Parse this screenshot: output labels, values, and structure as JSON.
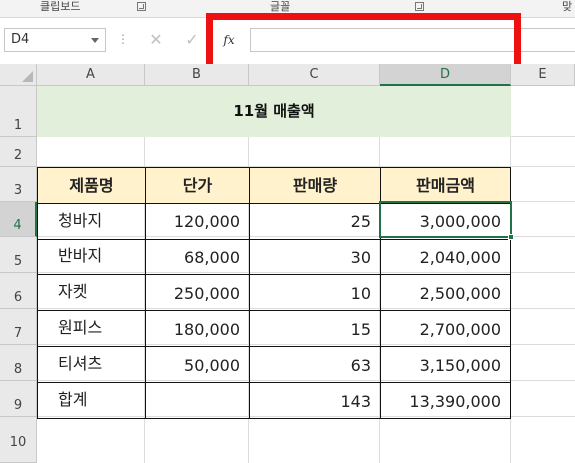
{
  "ribbon": {
    "groups": [
      "클립보드",
      "글꼴",
      "맞"
    ]
  },
  "formula_bar": {
    "name_box": "D4",
    "cancel_icon": "✕",
    "enter_icon": "✓",
    "fx_label": "fx",
    "formula": "",
    "dots": "⋮"
  },
  "grid": {
    "columns": [
      "A",
      "B",
      "C",
      "D",
      "E"
    ],
    "rows": [
      "1",
      "2",
      "3",
      "4",
      "5",
      "6",
      "7",
      "8",
      "9",
      "10"
    ],
    "selected_column": "D",
    "selected_row": "4",
    "active_cell": "D4"
  },
  "sheet": {
    "title": "11월 매출액",
    "headers": [
      "제품명",
      "단가",
      "판매량",
      "판매금액"
    ],
    "rows": [
      [
        "청바지",
        "120,000",
        "25",
        "3,000,000"
      ],
      [
        "반바지",
        "68,000",
        "30",
        "2,040,000"
      ],
      [
        "자켓",
        "250,000",
        "10",
        "2,500,000"
      ],
      [
        "원피스",
        "180,000",
        "15",
        "2,700,000"
      ],
      [
        "티셔츠",
        "50,000",
        "63",
        "3,150,000"
      ]
    ],
    "total": [
      "합계",
      "",
      "143",
      "13,390,000"
    ]
  },
  "colors": {
    "title_fill": "#e2efda",
    "header_fill": "#fff2cc",
    "selection": "#217346",
    "highlight_box": "#ee1111"
  }
}
